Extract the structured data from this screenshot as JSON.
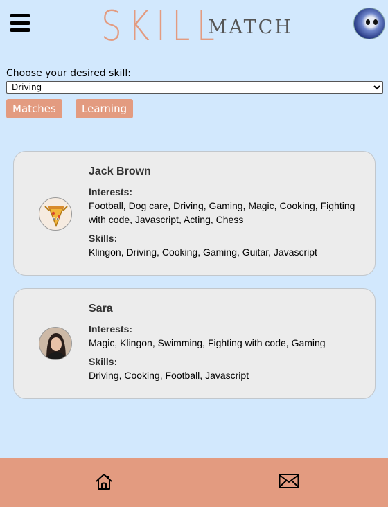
{
  "header": {
    "logo_primary": "SKILL",
    "logo_secondary": "MATCH",
    "menu_icon": "hamburger-menu-icon",
    "avatar_icon": "user-avatar"
  },
  "skill_picker": {
    "label": "Choose your desired skill:",
    "selected": "Driving"
  },
  "tabs": {
    "matches": "Matches",
    "learning": "Learning"
  },
  "section_labels": {
    "interests": "Interests:",
    "skills": "Skills:"
  },
  "matches": [
    {
      "name": "Jack Brown",
      "interests": "Football, Dog care, Driving, Gaming, Magic, Cooking, Fighting with code, Javascript, Acting, Chess",
      "skills": "Klingon, Driving, Cooking, Gaming, Guitar, Javascript"
    },
    {
      "name": "Sara",
      "interests": "Magic, Klingon, Swimming, Fighting with code, Gaming",
      "skills": "Driving, Cooking, Football, Javascript"
    }
  ],
  "footer": {
    "home_icon": "home-icon",
    "mail_icon": "mail-icon"
  },
  "colors": {
    "background": "#d2e8fd",
    "accent": "#e39b80",
    "card": "#ececec"
  }
}
